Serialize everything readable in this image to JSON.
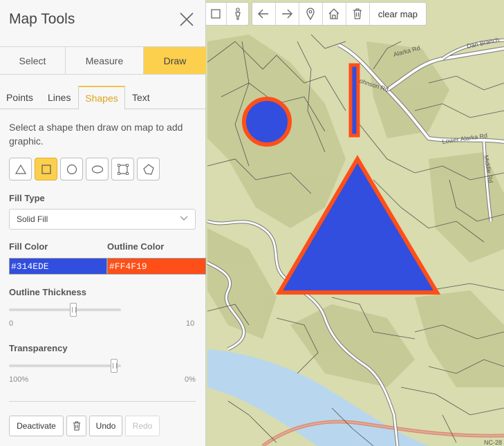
{
  "panel": {
    "title": "Map Tools",
    "mode_tabs": [
      "Select",
      "Measure",
      "Draw"
    ],
    "active_mode": "Draw",
    "sub_tabs": [
      "Points",
      "Lines",
      "Shapes",
      "Text"
    ],
    "active_sub_tab": "Shapes",
    "hint": "Select a shape then draw on map to add graphic.",
    "shape_tools": [
      "triangle-icon",
      "rectangle-icon",
      "circle-icon",
      "ellipse-icon",
      "square-icon",
      "freehand-polygon-icon"
    ],
    "active_shape": "rectangle-icon",
    "fill_type": {
      "label": "Fill Type",
      "value": "Solid Fill"
    },
    "fill_color": {
      "label": "Fill Color",
      "value": "#314EDE"
    },
    "outline_color": {
      "label": "Outline Color",
      "value": "#FF4F19"
    },
    "outline_thickness": {
      "label": "Outline Thickness",
      "min": "0",
      "max": "10",
      "value": 5.8
    },
    "transparency": {
      "label": "Transparency",
      "min": "100%",
      "max": "0%",
      "value": 0.97
    },
    "actions": {
      "deactivate": "Deactivate",
      "undo": "Undo",
      "redo": "Redo"
    }
  },
  "toolbar": {
    "left_icons": [
      "square-select-icon",
      "person-icon"
    ],
    "right_icons": [
      "arrow-left-icon",
      "arrow-right-icon",
      "map-pin-icon",
      "home-icon",
      "trash-icon"
    ],
    "clear_label": "clear map"
  },
  "map": {
    "road_labels": [
      "Lower Alarka Rd",
      "Johnson Rd",
      "Alarka Rd",
      "Dan Branch",
      "Middle Rd",
      "NC-28"
    ],
    "graphics": {
      "fill": "#314EDE",
      "outline": "#FF4F19"
    },
    "colors": {
      "land": "#d8dcae",
      "ridge": "#c5c995",
      "water": "#b8d7ee",
      "road": "#ffffff",
      "parcel": "#555555"
    }
  }
}
